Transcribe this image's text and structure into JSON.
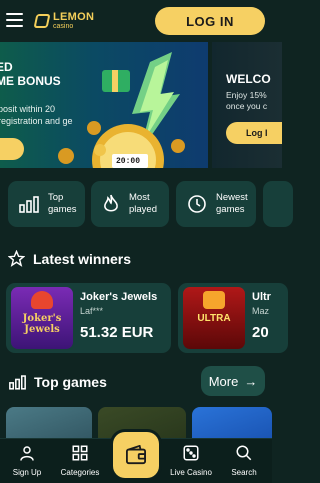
{
  "header": {
    "logo_main": "LEMON",
    "logo_sub": "casino",
    "login_label": "LOG IN"
  },
  "banners": [
    {
      "title_lines": [
        "ED",
        "ME BONUS"
      ],
      "text_lines": [
        "posit within 20",
        "registration and ge"
      ]
    },
    {
      "title": "WELCO",
      "text_lines": [
        "Enjoy 15%",
        "once you c"
      ],
      "button_label": "Log I"
    }
  ],
  "banner_clock_text": "20:00",
  "categories": [
    {
      "label_lines": [
        "Top",
        "games"
      ],
      "icon": "bar-chart-icon"
    },
    {
      "label_lines": [
        "Most",
        "played"
      ],
      "icon": "flame-icon"
    },
    {
      "label_lines": [
        "Newest",
        "games"
      ],
      "icon": "clock-icon"
    }
  ],
  "latest_winners": {
    "title": "Latest winners",
    "items": [
      {
        "game": "Joker's Jewels",
        "user": "Laf***",
        "amount": "51.32 EUR",
        "thumb_text": "Joker's Jewels"
      },
      {
        "game": "Ultr",
        "user": "Maz",
        "amount": "20",
        "thumb_text": "ULTRA"
      }
    ]
  },
  "top_games": {
    "title": "Top games",
    "more_label": "More"
  },
  "bottom_nav": {
    "items": [
      {
        "label": "Sign Up",
        "icon": "user-icon"
      },
      {
        "label": "Categories",
        "icon": "categories-icon"
      },
      {
        "label": "Live Casino",
        "icon": "dice-icon"
      },
      {
        "label": "Search",
        "icon": "search-icon"
      }
    ],
    "center_icon": "wallet-icon"
  },
  "colors": {
    "background": "#0f2421",
    "card": "#173f3a",
    "accent": "#f6d063"
  }
}
